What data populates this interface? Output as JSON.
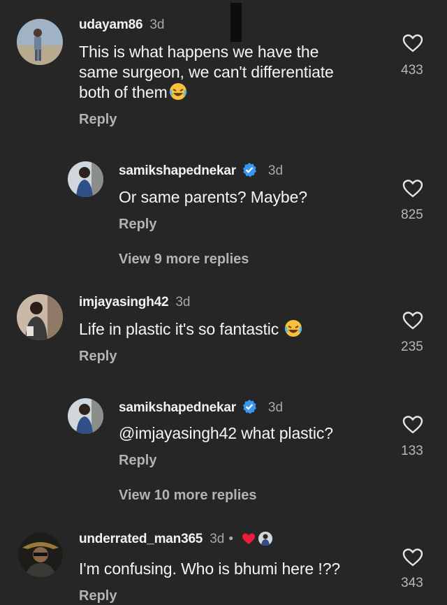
{
  "colors": {
    "background": "#262626",
    "text": "#f5f5f5",
    "secondary": "#a8a8a8",
    "verified": "#3897f0",
    "heart_red": "#ed1c3a"
  },
  "comments": [
    {
      "username": "udayam86",
      "time": "3d",
      "lines": [
        "This is what happens we have the",
        "same surgeon, we can't differentiate",
        "both of them"
      ],
      "emoji": "😂",
      "reply_label": "Reply",
      "likes": "433",
      "icon": "heart-outline-icon"
    },
    {
      "username": "samikshapednekar",
      "verified": true,
      "time": "3d",
      "text": "Or same parents? Maybe?",
      "reply_label": "Reply",
      "likes": "825",
      "view_more": "View 9 more replies"
    },
    {
      "username": "imjayasingh42",
      "time": "3d",
      "text": "Life in plastic it's so fantastic",
      "emoji": "😂",
      "reply_label": "Reply",
      "likes": "235"
    },
    {
      "username": "samikshapednekar",
      "verified": true,
      "time": "3d",
      "text": "@imjayasingh42 what plastic?",
      "reply_label": "Reply",
      "likes": "133",
      "view_more": "View 10 more replies"
    },
    {
      "username": "underrated_man365",
      "time": "3d",
      "text": "I'm confusing.  Who is bhumi here !??",
      "reply_label": "Reply",
      "likes": "343",
      "liked_by_author": true
    }
  ]
}
